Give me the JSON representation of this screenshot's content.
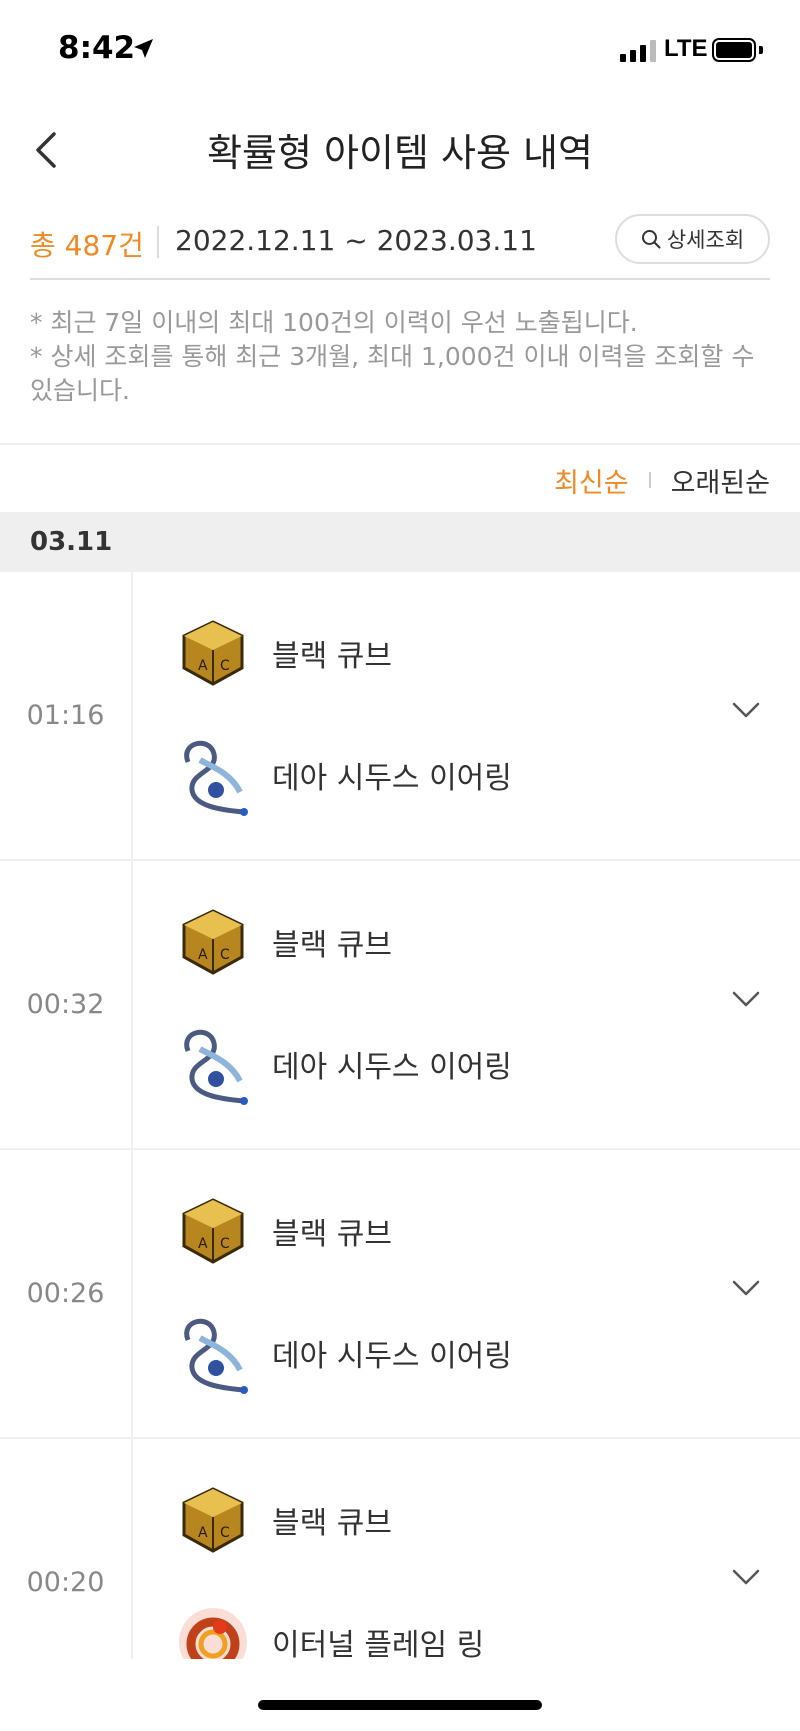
{
  "status": {
    "time": "8:42",
    "network": "LTE",
    "location_icon": "location-arrow-icon"
  },
  "header": {
    "title": "확률형 아이템 사용 내역",
    "back_icon": "chevron-left-icon"
  },
  "summary": {
    "total_label": "총 487건",
    "date_range": "2022.12.11 ~ 2023.03.11",
    "detail_button": "상세조회",
    "detail_icon": "search-icon"
  },
  "notes": [
    "* 최근 7일 이내의 최대 100건의 이력이 우선 노출됩니다.",
    "* 상세 조회를 통해 최근 3개월, 최대 1,000건 이내 이력을 조회할 수 있습니다."
  ],
  "sort": {
    "newest": "최신순",
    "oldest": "오래된순",
    "active_color": "#f08a24"
  },
  "date_group": "03.11",
  "entries": [
    {
      "time": "01:16",
      "items": [
        {
          "name": "블랙 큐브",
          "icon": "black-cube-icon"
        },
        {
          "name": "데아 시두스 이어링",
          "icon": "earring-icon"
        }
      ]
    },
    {
      "time": "00:32",
      "items": [
        {
          "name": "블랙 큐브",
          "icon": "black-cube-icon"
        },
        {
          "name": "데아 시두스 이어링",
          "icon": "earring-icon"
        }
      ]
    },
    {
      "time": "00:26",
      "items": [
        {
          "name": "블랙 큐브",
          "icon": "black-cube-icon"
        },
        {
          "name": "데아 시두스 이어링",
          "icon": "earring-icon"
        }
      ]
    },
    {
      "time": "00:20",
      "items": [
        {
          "name": "블랙 큐브",
          "icon": "black-cube-icon"
        },
        {
          "name": "이터널 플레임 링",
          "icon": "ring-icon"
        }
      ]
    }
  ]
}
